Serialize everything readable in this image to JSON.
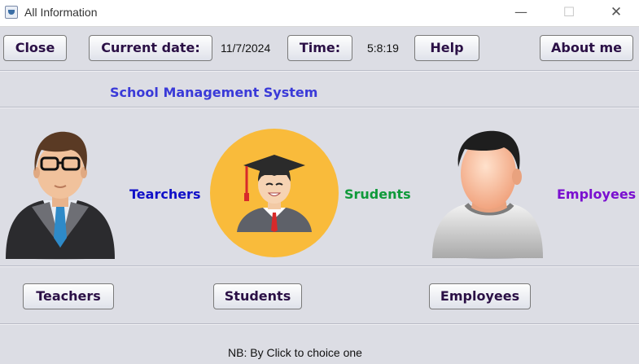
{
  "window": {
    "title": "All Information"
  },
  "toolbar": {
    "close_label": "Close",
    "current_date_label": "Current date:",
    "date_value": "11/7/2024",
    "time_label": "Time:",
    "time_value": "5:8:19",
    "help_label": "Help",
    "about_label": "About me"
  },
  "header": {
    "title": "School Management System"
  },
  "categories": {
    "teachers_label": "Tearchers",
    "students_label": "Srudents",
    "employees_label": "Employees"
  },
  "buttons": {
    "teachers": "Teachers",
    "students": "Students",
    "employees": "Employees"
  },
  "footer": {
    "note": "NB: By Click to choice  one"
  },
  "colors": {
    "window_bg": "#dcdde4",
    "title_blue": "#3a3ad8",
    "teachers_label": "#1010c8",
    "students_label": "#0f9a3a",
    "employees_label": "#7a0fd0",
    "student_circle": "#f9bb3b"
  },
  "icons": {
    "teacher": "teacher-avatar-icon",
    "student": "graduate-avatar-icon",
    "employee": "employee-avatar-icon"
  }
}
